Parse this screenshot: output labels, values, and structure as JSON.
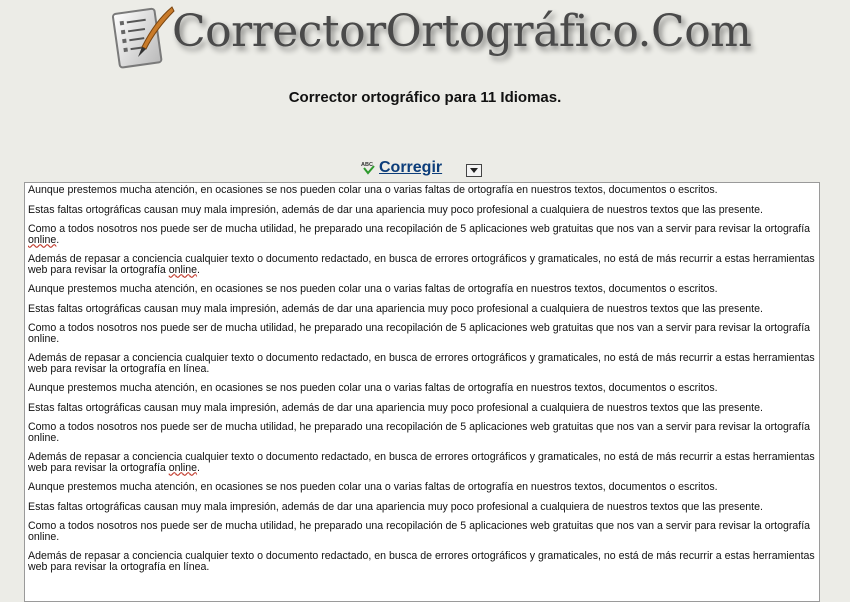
{
  "header": {
    "logo_text": "CorrectorOrtográfico.Com",
    "tagline": "Corrector ortográfico para 11 Idiomas."
  },
  "toolbar": {
    "corregir_label": "Corregir",
    "abc_icon_label": "ABC"
  },
  "editor": {
    "paragraphs": [
      {
        "text": "Aunque prestemos mucha atención, en ocasiones se nos pueden colar una o varias faltas de ortografía en nuestros textos, documentos o escritos."
      },
      {
        "text": "Estas faltas ortográficas causan muy mala impresión, además de dar una apariencia muy poco profesional a cualquiera de nuestros textos que las presente."
      },
      {
        "text": "Como a todos nosotros nos puede ser de mucha utilidad, he preparado una recopilación de 5 aplicaciones web gratuitas que nos van a servir para revisar la ortografía",
        "flagged": "online",
        "after": "."
      },
      {
        "text": "Además de repasar a conciencia cualquier texto o documento redactado, en busca de errores ortográficos y gramaticales, no está de más recurrir a estas herramientas web para revisar la ortografía",
        "flagged": "online",
        "after": "."
      },
      {
        "text": "Aunque prestemos mucha atención, en ocasiones se nos pueden colar una o varias faltas de ortografía en nuestros textos, documentos o escritos."
      },
      {
        "text": "Estas faltas ortográficas causan muy mala impresión, además de dar una apariencia muy poco profesional a cualquiera de nuestros textos que las presente."
      },
      {
        "text": "Como a todos nosotros nos puede ser de mucha utilidad, he preparado una recopilación de 5 aplicaciones web gratuitas que nos van a servir para revisar la ortografía online."
      },
      {
        "text": "Además de repasar a conciencia cualquier texto o documento redactado, en busca de errores ortográficos y gramaticales, no está de más recurrir a estas herramientas web para revisar la ortografía en línea."
      },
      {
        "text": "Aunque prestemos mucha atención, en ocasiones se nos pueden colar una o varias faltas de ortografía en nuestros textos, documentos o escritos."
      },
      {
        "text": "Estas faltas ortográficas causan muy mala impresión, además de dar una apariencia muy poco profesional a cualquiera de nuestros textos que las presente."
      },
      {
        "text": "Como a todos nosotros nos puede ser de mucha utilidad, he preparado una recopilación de 5 aplicaciones web gratuitas que nos van a servir para revisar la ortografía online."
      },
      {
        "text": "Además de repasar a conciencia cualquier texto o documento redactado, en busca de errores ortográficos y gramaticales, no está de más recurrir a estas herramientas web para revisar la ortografía",
        "flagged": "online",
        "after": "."
      },
      {
        "text": "Aunque prestemos mucha atención, en ocasiones se nos pueden colar una o varias faltas de ortografía en nuestros textos, documentos o escritos."
      },
      {
        "text": "Estas faltas ortográficas causan muy mala impresión, además de dar una apariencia muy poco profesional a cualquiera de nuestros textos que las presente."
      },
      {
        "text": "Como a todos nosotros nos puede ser de mucha utilidad, he preparado una recopilación de 5 aplicaciones web gratuitas que nos van a servir para revisar la ortografía online."
      },
      {
        "text": "Además de repasar a conciencia cualquier texto o documento redactado, en busca de errores ortográficos y gramaticales, no está de más recurrir a estas herramientas web para revisar la ortografía en línea."
      }
    ]
  },
  "colors": {
    "page_bg": "#ecece7",
    "link": "#0c3d7a",
    "misspelling_underline": "#c0392b"
  }
}
